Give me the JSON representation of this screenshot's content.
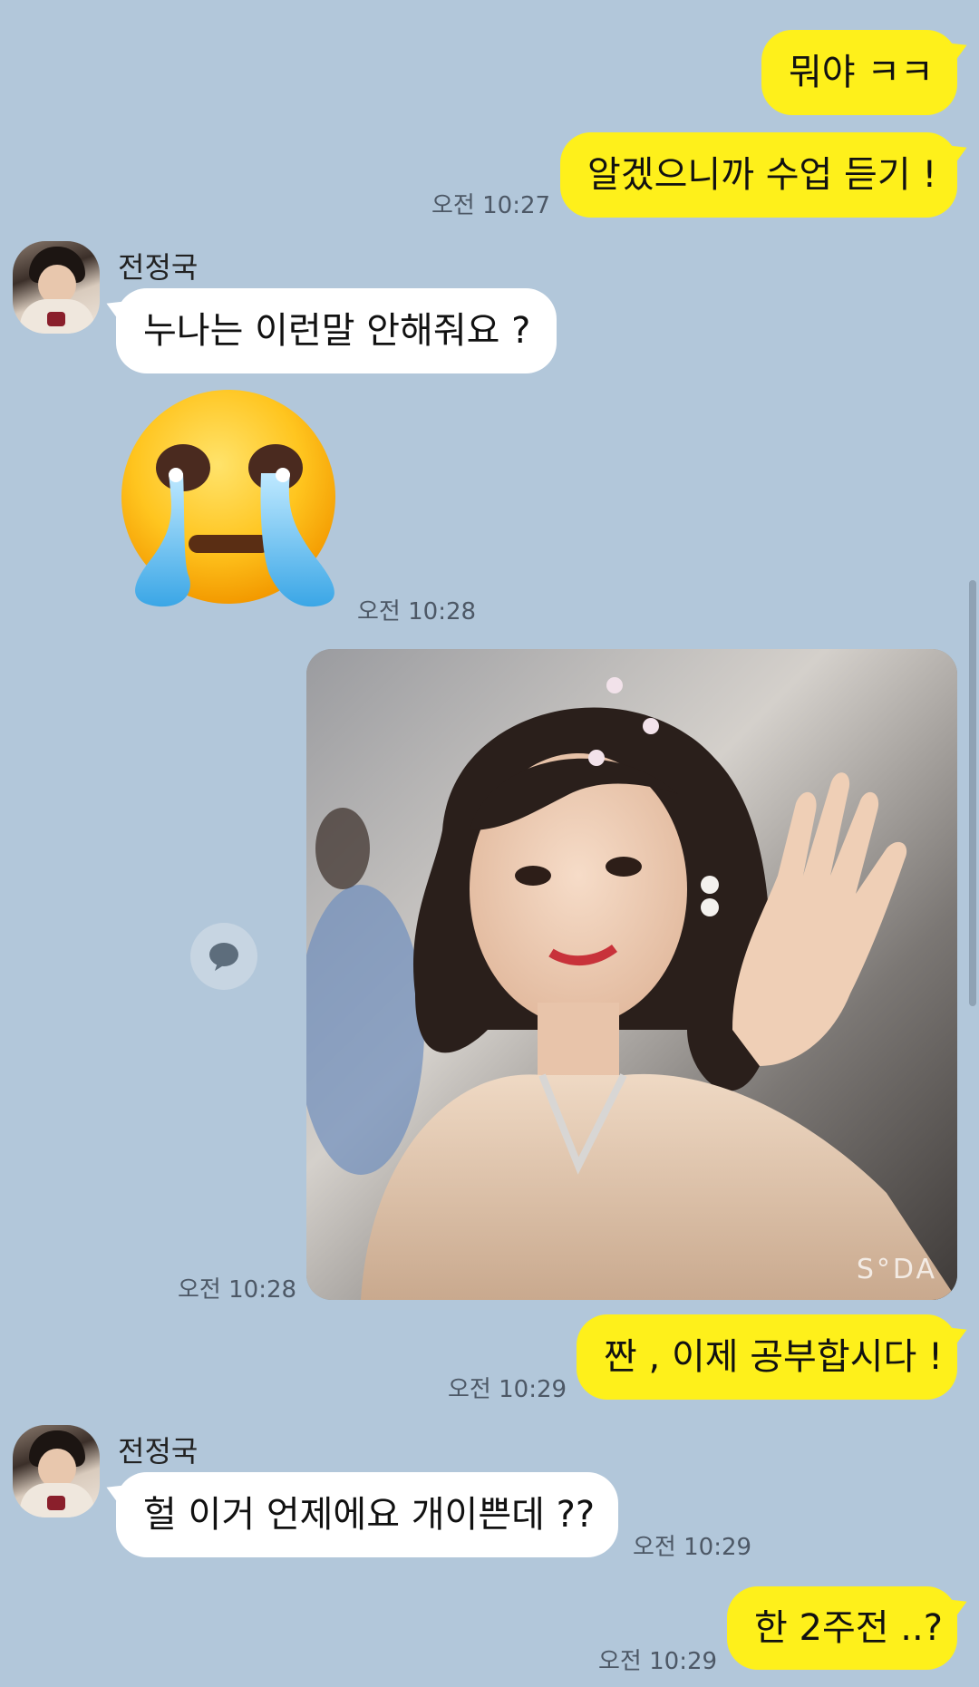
{
  "messages": {
    "m1": {
      "text": "뭐야 ㅋㅋ"
    },
    "m2": {
      "text": "알겠으니까 수업 듣기 !",
      "time": "오전 10:27"
    },
    "m3": {
      "sender": "전정국",
      "text": "누나는 이런말 안해줘요 ?"
    },
    "m4": {
      "emoji": "loudly-crying-emoticon",
      "time": "오전 10:28"
    },
    "m5": {
      "photo": "selfie-photo",
      "watermark": "S°DA",
      "time": "오전 10:28"
    },
    "m6": {
      "text": "짠 , 이제 공부합시다 !",
      "time": "오전 10:29"
    },
    "m7": {
      "sender": "전정국",
      "text": "헐 이거 언제에요 개이쁜데 ??",
      "time": "오전 10:29"
    },
    "m8": {
      "text": "한 2주전 ..?",
      "time": "오전 10:29"
    }
  },
  "colors": {
    "background": "#b2c7da",
    "my_bubble": "#fef01b",
    "their_bubble": "#ffffff"
  }
}
